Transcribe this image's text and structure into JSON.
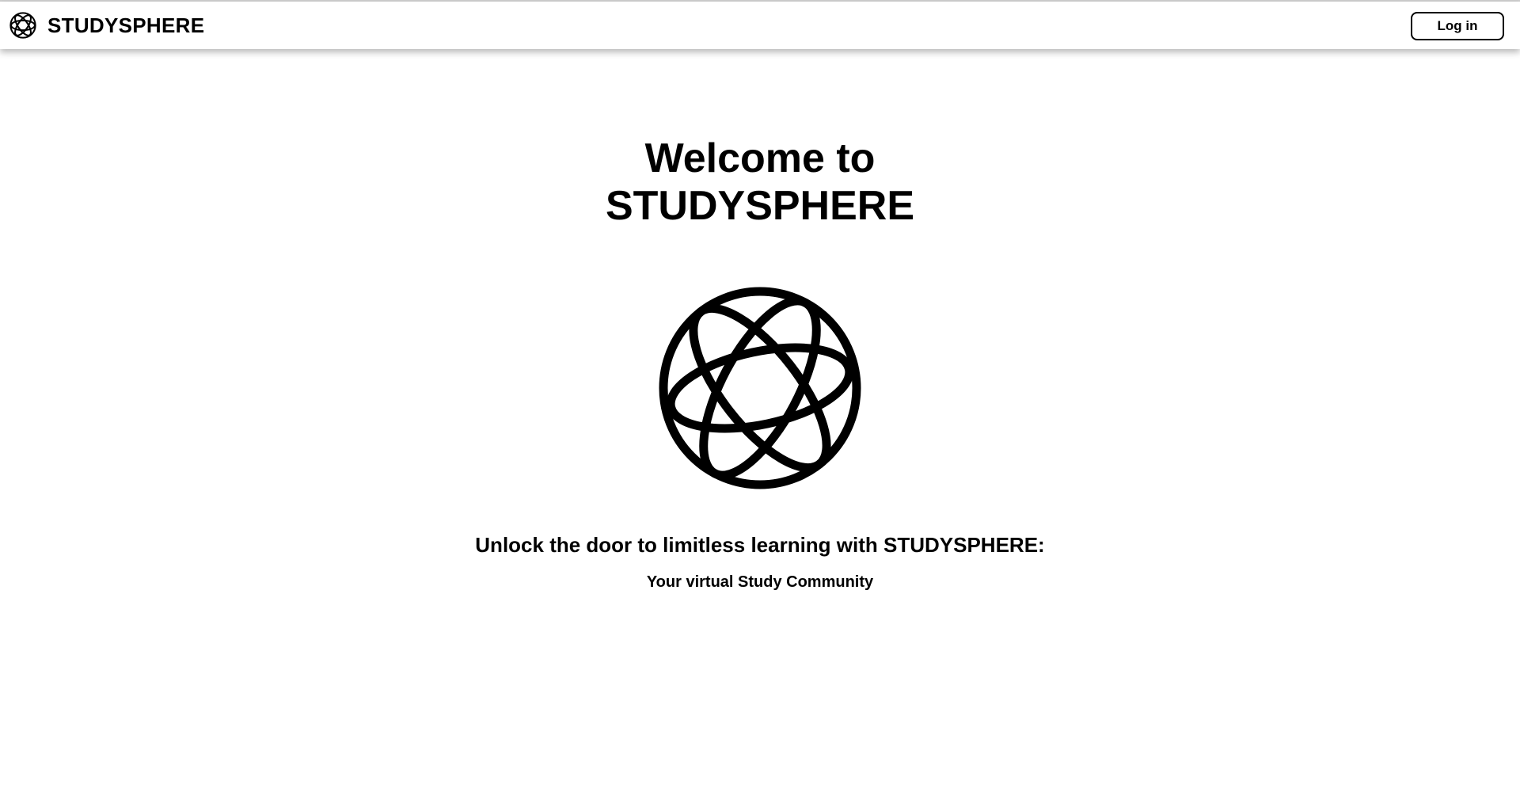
{
  "navbar": {
    "brand_name": "STUDYSPHERE",
    "logo_icon": "globe-orbit-icon",
    "login_label": "Log in"
  },
  "hero": {
    "title_line1": "Welcome to",
    "title_line2": "STUDYSPHERE",
    "logo_icon": "globe-orbit-icon",
    "tagline": "Unlock the door to limitless learning with STUDYSPHERE:",
    "subtagline": "Your virtual Study Community"
  },
  "colors": {
    "background": "#ffffff",
    "text": "#000000",
    "button_border": "#000000"
  }
}
